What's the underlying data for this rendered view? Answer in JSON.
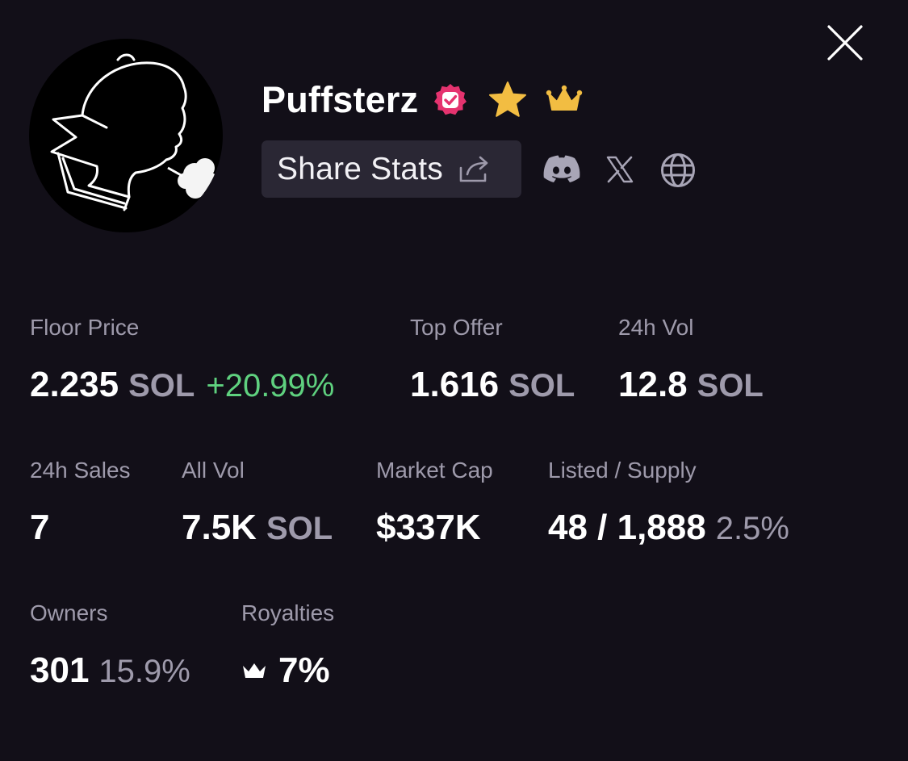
{
  "header": {
    "title": "Puffsterz",
    "badges": [
      "verified-icon",
      "star-icon",
      "crown-icon"
    ]
  },
  "actions": {
    "share_label": "Share Stats",
    "social_links": [
      "discord-icon",
      "x-icon",
      "globe-icon"
    ]
  },
  "stats": {
    "floor_price": {
      "label": "Floor Price",
      "value": "2.235",
      "unit": "SOL",
      "change": "+20.99%"
    },
    "top_offer": {
      "label": "Top Offer",
      "value": "1.616",
      "unit": "SOL"
    },
    "vol_24h": {
      "label": "24h Vol",
      "value": "12.8",
      "unit": "SOL"
    },
    "sales_24h": {
      "label": "24h Sales",
      "value": "7"
    },
    "all_vol": {
      "label": "All Vol",
      "value": "7.5K",
      "unit": "SOL"
    },
    "market_cap": {
      "label": "Market Cap",
      "value": "$337K"
    },
    "listed_supply": {
      "label": "Listed / Supply",
      "value": "48 / 1,888",
      "percent": "2.5%"
    },
    "owners": {
      "label": "Owners",
      "value": "301",
      "percent": "15.9%"
    },
    "royalties": {
      "label": "Royalties",
      "value": "7%"
    }
  },
  "colors": {
    "background": "#120f18",
    "muted_text": "#9e9aab",
    "positive": "#5fd17f",
    "verified": "#e5336f",
    "gold": "#f2bd42",
    "button_bg": "#2a2734"
  }
}
